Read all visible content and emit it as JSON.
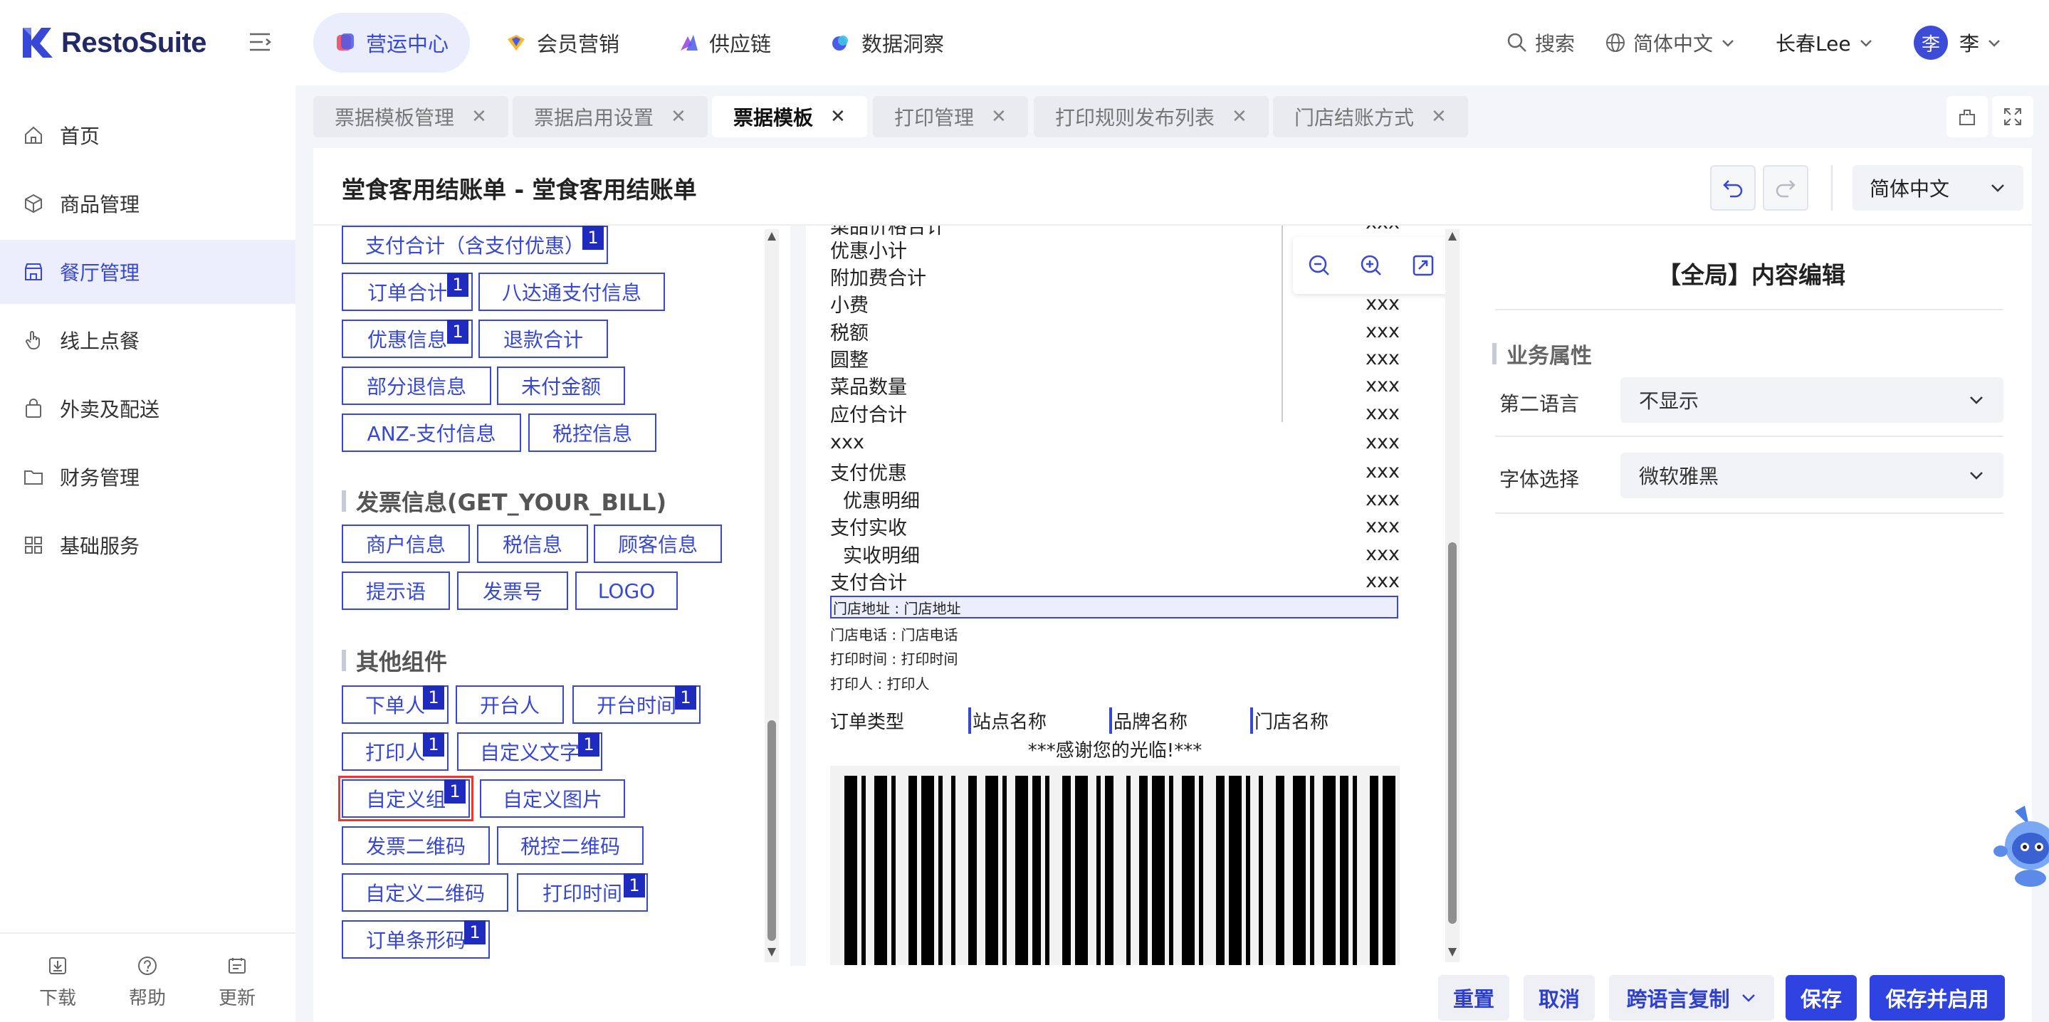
{
  "app": {
    "name": "RestoSuite"
  },
  "topnav": {
    "tabs": [
      {
        "label": "营运中心",
        "active": true
      },
      {
        "label": "会员营销",
        "active": false
      },
      {
        "label": "供应链",
        "active": false
      },
      {
        "label": "数据洞察",
        "active": false
      }
    ],
    "search": "搜索",
    "language": "简体中文",
    "store": "长春Lee",
    "avatar_char": "李",
    "user": "李"
  },
  "sidebar": {
    "items": [
      {
        "label": "首页",
        "icon": "home-icon"
      },
      {
        "label": "商品管理",
        "icon": "cube-icon"
      },
      {
        "label": "餐厅管理",
        "icon": "store-icon",
        "active": true
      },
      {
        "label": "线上点餐",
        "icon": "hand-pointer-icon"
      },
      {
        "label": "外卖及配送",
        "icon": "bag-icon"
      },
      {
        "label": "财务管理",
        "icon": "folder-icon"
      },
      {
        "label": "基础服务",
        "icon": "grid-icon"
      }
    ],
    "footer": {
      "download": "下载",
      "help": "帮助",
      "update": "更新"
    }
  },
  "page_tabs": [
    {
      "label": "票据模板管理"
    },
    {
      "label": "票据启用设置"
    },
    {
      "label": "票据模板",
      "active": true
    },
    {
      "label": "打印管理"
    },
    {
      "label": "打印规则发布列表"
    },
    {
      "label": "门店结账方式"
    }
  ],
  "header": {
    "title": "堂食客用结账单 - 堂食客用结账单",
    "language_select": "简体中文"
  },
  "components": {
    "top_items": [
      {
        "label": "支付合计（含支付优惠）",
        "badge": "1"
      },
      {
        "label": "订单合计",
        "badge": "1"
      },
      {
        "label": "八达通支付信息"
      },
      {
        "label": "优惠信息",
        "badge": "1"
      },
      {
        "label": "退款合计"
      },
      {
        "label": "部分退信息"
      },
      {
        "label": "未付金额"
      },
      {
        "label": "ANZ-支付信息"
      },
      {
        "label": "税控信息"
      }
    ],
    "invoice_section": "发票信息(GET_YOUR_BILL)",
    "invoice_items": [
      {
        "label": "商户信息"
      },
      {
        "label": "税信息"
      },
      {
        "label": "顾客信息"
      },
      {
        "label": "提示语"
      },
      {
        "label": "发票号"
      },
      {
        "label": "LOGO"
      }
    ],
    "other_section": "其他组件",
    "other_items": [
      {
        "label": "下单人",
        "badge": "1"
      },
      {
        "label": "开台人"
      },
      {
        "label": "开台时间",
        "badge": "1"
      },
      {
        "label": "打印人",
        "badge": "1"
      },
      {
        "label": "自定义文字",
        "badge": "1"
      },
      {
        "label": "自定义组",
        "badge": "1",
        "selected": true
      },
      {
        "label": "自定义图片"
      },
      {
        "label": "发票二维码"
      },
      {
        "label": "税控二维码"
      },
      {
        "label": "自定义二维码"
      },
      {
        "label": "打印时间",
        "badge": "1"
      },
      {
        "label": "订单条形码",
        "badge": "1"
      }
    ]
  },
  "receipt": {
    "cut_row": "菜品价格合计",
    "rows": [
      {
        "label": "优惠小计",
        "value": ""
      },
      {
        "label": "附加费合计",
        "value": ""
      },
      {
        "label": "小费",
        "value": "xxx"
      },
      {
        "label": "税额",
        "value": "xxx"
      },
      {
        "label": "圆整",
        "value": "xxx"
      },
      {
        "label": "菜品数量",
        "value": "xxx"
      },
      {
        "label": "应付合计",
        "value": "xxx"
      },
      {
        "label": "xxx",
        "value": "xxx"
      },
      {
        "label": "支付优惠",
        "value": "xxx"
      },
      {
        "label": "优惠明细",
        "value": "xxx",
        "indent": true
      },
      {
        "label": "支付实收",
        "value": "xxx"
      },
      {
        "label": "实收明细",
        "value": "xxx",
        "indent": true
      },
      {
        "label": "支付合计",
        "value": "xxx"
      }
    ],
    "cut_value": "xxx",
    "store_address": "门店地址 : 门店地址",
    "store_phone": "门店电话 : 门店电话",
    "print_time": "打印时间 : 打印时间",
    "printer": "打印人 : 打印人",
    "order_type": "订单类型",
    "site_name": "站点名称",
    "brand_name": "品牌名称",
    "store_name": "门店名称",
    "thanks": "***感谢您的光临!***"
  },
  "right_panel": {
    "title": "【全局】内容编辑",
    "section": "业务属性",
    "second_language_label": "第二语言",
    "second_language_value": "不显示",
    "font_label": "字体选择",
    "font_value": "微软雅黑"
  },
  "footer_buttons": {
    "reset": "重置",
    "cancel": "取消",
    "copy_lang": "跨语言复制",
    "save": "保存",
    "save_enable": "保存并启用"
  },
  "colors": {
    "accent": "#3747d6",
    "badge": "#1f2bbf",
    "selected_outline": "#e53935"
  }
}
